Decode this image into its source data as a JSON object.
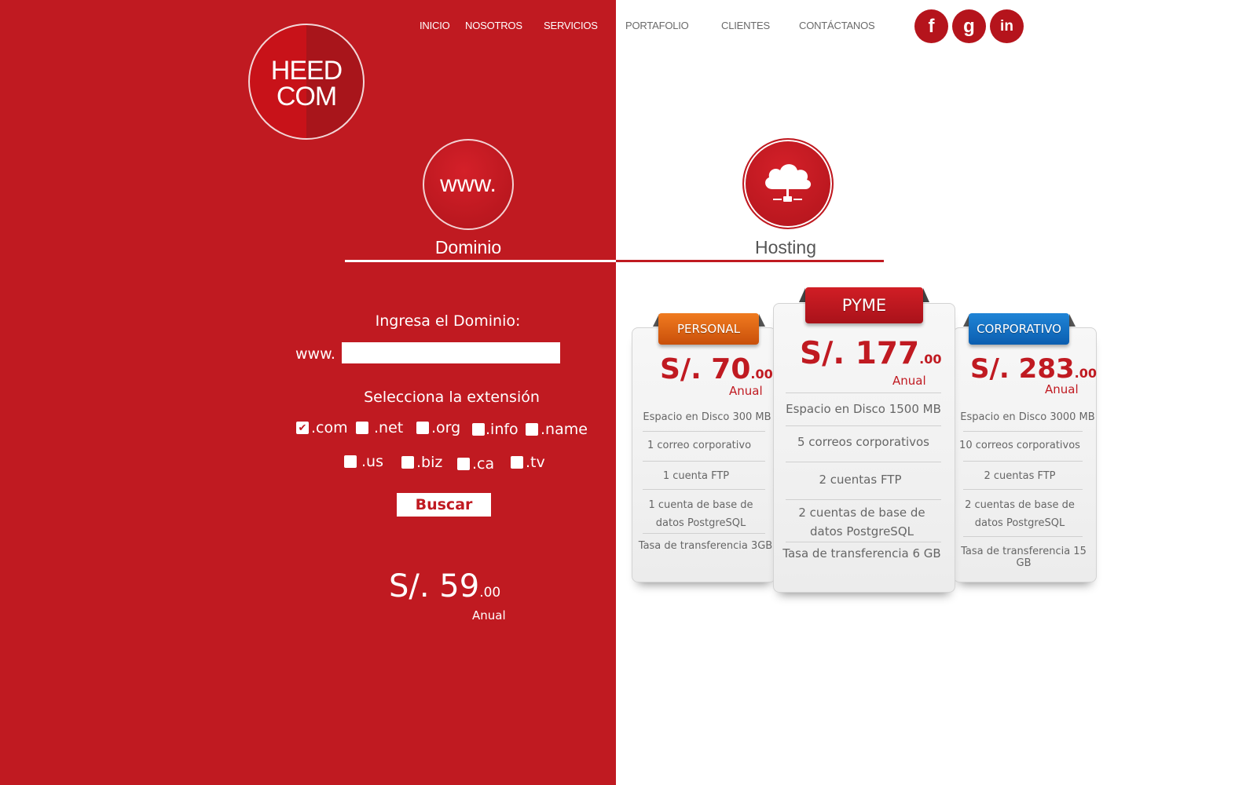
{
  "nav": {
    "items": [
      "INICIO",
      "NOSOTROS",
      "SERVICIOS",
      "PORTAFOLIO",
      "CLIENTES",
      "CONTÁCTANOS"
    ]
  },
  "social": {
    "facebook": "f",
    "google": "g",
    "linkedin": "in"
  },
  "logo": {
    "line1": "HEED",
    "line2": "COM"
  },
  "tabs": {
    "domain_icon_text": "www.",
    "domain_label": "Dominio",
    "hosting_label": "Hosting"
  },
  "domain_form": {
    "title": "Ingresa el Dominio:",
    "prefix": "www.",
    "input_value": "",
    "extension_title": "Selecciona la extensión",
    "extensions": [
      {
        "label": ".com",
        "checked": true
      },
      {
        "label": ".net",
        "checked": false
      },
      {
        "label": ".org",
        "checked": false
      },
      {
        "label": ".info",
        "checked": false
      },
      {
        "label": ".name",
        "checked": false
      },
      {
        "label": ".us",
        "checked": false
      },
      {
        "label": ".biz",
        "checked": false
      },
      {
        "label": ".ca",
        "checked": false
      },
      {
        "label": ".tv",
        "checked": false
      }
    ],
    "button": "Buscar",
    "price_main": "S/. 59",
    "price_cents": ".00",
    "period": "Anual"
  },
  "plans": [
    {
      "name": "PERSONAL",
      "price_main": "S/. 70",
      "price_cents": ".00",
      "period": "Anual",
      "features": [
        "Espacio en Disco 300 MB",
        "1  correo corporativo",
        "1 cuenta FTP",
        "1 cuenta de base de datos PostgreSQL",
        "Tasa de transferencia 3GB"
      ]
    },
    {
      "name": "PYME",
      "price_main": "S/. 177",
      "price_cents": ".00",
      "period": "Anual",
      "features": [
        "Espacio en Disco 1500 MB",
        "5 correos corporativos",
        "2 cuentas FTP",
        "2 cuentas de base de datos PostgreSQL",
        "Tasa de transferencia 6 GB"
      ]
    },
    {
      "name": "CORPORATIVO",
      "price_main": "S/. 283",
      "price_cents": ".00",
      "period": "Anual",
      "features": [
        "Espacio en Disco 3000 MB",
        "10 correos corporativos",
        "2 cuentas FTP",
        "2 cuentas de base de datos PostgreSQL",
        "Tasa de transferencia 15 GB"
      ]
    }
  ],
  "colors": {
    "brand_red": "#c01a21",
    "personal": "#e0661a",
    "pyme": "#c01a21",
    "corporativo": "#1270c4"
  }
}
